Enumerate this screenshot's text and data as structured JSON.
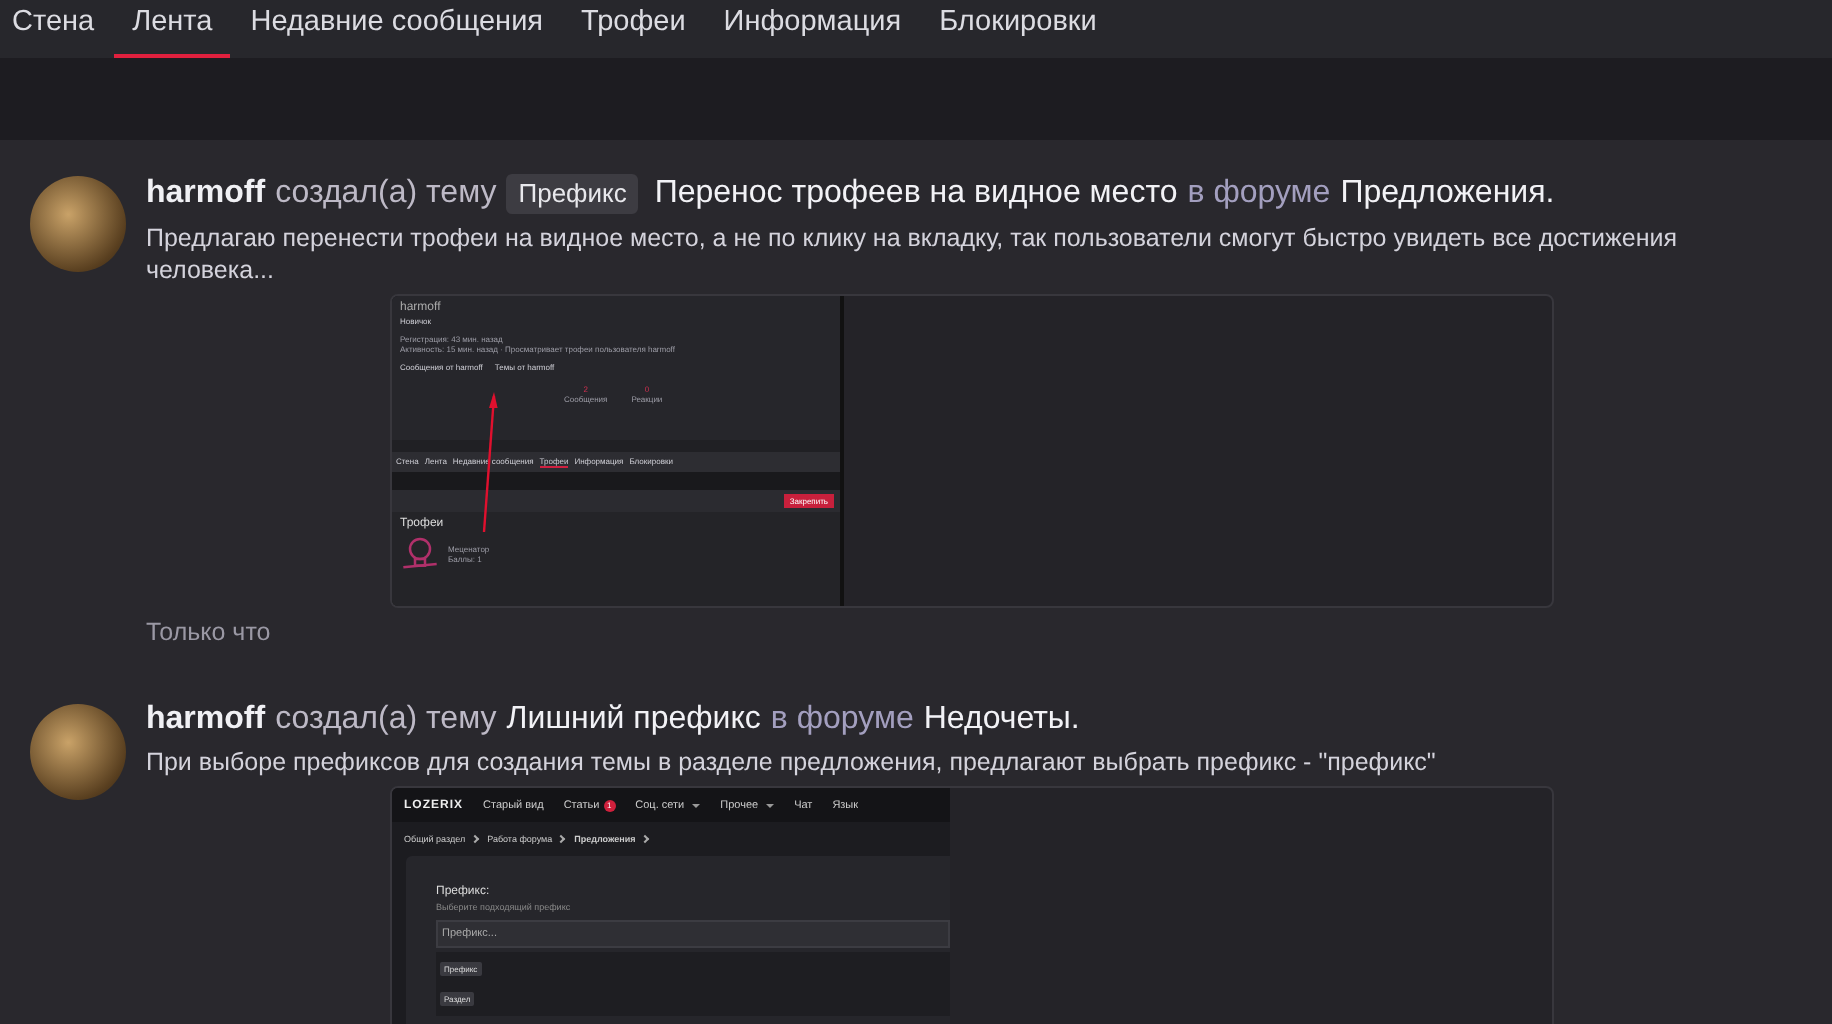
{
  "tabs": [
    {
      "label": "Стена",
      "selected": false
    },
    {
      "label": "Лента",
      "selected": true
    },
    {
      "label": "Недавние сообщения",
      "selected": false
    },
    {
      "label": "Трофеи",
      "selected": false
    },
    {
      "label": "Информация",
      "selected": false
    },
    {
      "label": "Блокировки",
      "selected": false
    }
  ],
  "posts": [
    {
      "author": "harmoff",
      "action": "создал(а) тему",
      "prefix": "Префикс",
      "title": "Перенос трофеев на видное место",
      "in_forum": "в форуме",
      "forum": "Предложения",
      "end": ".",
      "excerpt": "Предлагаю перенести трофеи на видное место, а не по клику на вкладку, так пользователи смогут быстро увидеть все достижения человека...",
      "time": "Только что",
      "attachment": {
        "kind": "profile",
        "name": "harmoff",
        "rank": "Новичок",
        "lines": [
          {
            "label": "Регистрация:",
            "value": "43 мин. назад"
          },
          {
            "label": "Активность:",
            "value": "15 мин. назад · Просматривает трофеи пользователя harmoff"
          }
        ],
        "links": [
          "Сообщения от harmoff",
          "Темы от harmoff"
        ],
        "stats": [
          {
            "value": "2",
            "label": "Сообщения"
          },
          {
            "value": "0",
            "label": "Реакции"
          }
        ],
        "tabs": [
          {
            "label": "Стена",
            "selected": false
          },
          {
            "label": "Лента",
            "selected": false
          },
          {
            "label": "Недавние сообщения",
            "selected": false
          },
          {
            "label": "Трофеи",
            "selected": true
          },
          {
            "label": "Информация",
            "selected": false
          },
          {
            "label": "Блокировки",
            "selected": false
          }
        ],
        "button": "Закрепить",
        "section": "Трофеи",
        "trophy": {
          "name": "Меценатор",
          "points": "Баллы: 1"
        }
      }
    },
    {
      "author": "harmoff",
      "action": "создал(а) тему",
      "title": "Лишний префикс",
      "in_forum": "в форуме",
      "forum": "Недочеты",
      "end": ".",
      "excerpt": "При выборе префиксов для создания темы в разделе предложения, предлагают выбрать префикс - \"префикс\"",
      "attachment": {
        "kind": "form",
        "logo": "LOZERIX",
        "nav": [
          {
            "label": "Старый вид"
          },
          {
            "label": "Статьи",
            "badge": "1"
          },
          {
            "label": "Соц. сети",
            "dropdown": true
          },
          {
            "label": "Прочее",
            "dropdown": true
          },
          {
            "label": "Чат"
          },
          {
            "label": "Язык"
          }
        ],
        "breadcrumbs": [
          "Общий раздел",
          "Работа форума",
          "Предложения"
        ],
        "field_label": "Префикс:",
        "field_hint": "Выберите подходящий префикс",
        "placeholder": "Префикс...",
        "options": [
          "Префикс",
          "Раздел"
        ]
      }
    }
  ]
}
